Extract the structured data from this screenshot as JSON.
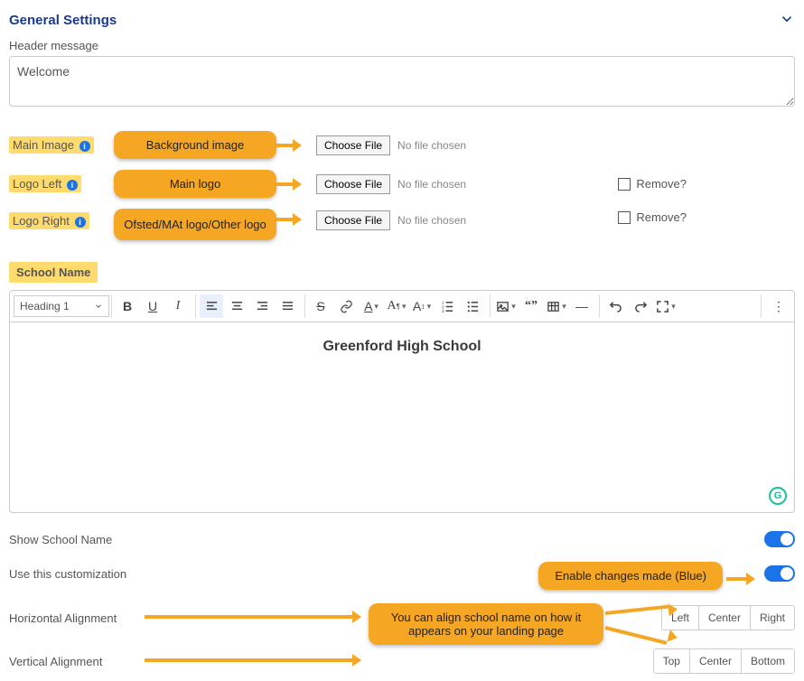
{
  "section_title": "General Settings",
  "header_message": {
    "label": "Header message",
    "value": "Welcome"
  },
  "main_image": {
    "label": "Main Image",
    "choose": "Choose File",
    "status": "No file chosen"
  },
  "logo_left": {
    "label": "Logo Left",
    "choose": "Choose File",
    "status": "No file chosen",
    "remove": "Remove?"
  },
  "logo_right": {
    "label": "Logo Right",
    "choose": "Choose File",
    "status": "No file chosen",
    "remove": "Remove?"
  },
  "callouts": {
    "bg": "Background image",
    "main_logo": "Main logo",
    "other_logo": "Ofsted/MAt logo/Other logo",
    "enable": "Enable changes made (Blue)",
    "align": "You can align school name on how it appears on your landing page"
  },
  "school_name": {
    "label": "School Name"
  },
  "toolbar": {
    "heading": "Heading 1"
  },
  "editor_content": "Greenford High School",
  "show_school_name": {
    "label": "Show School Name"
  },
  "use_custom": {
    "label": "Use this customization"
  },
  "h_align": {
    "label": "Horizontal Alignment",
    "options": [
      "Left",
      "Center",
      "Right"
    ]
  },
  "v_align": {
    "label": "Vertical Alignment",
    "options": [
      "Top",
      "Center",
      "Bottom"
    ]
  }
}
